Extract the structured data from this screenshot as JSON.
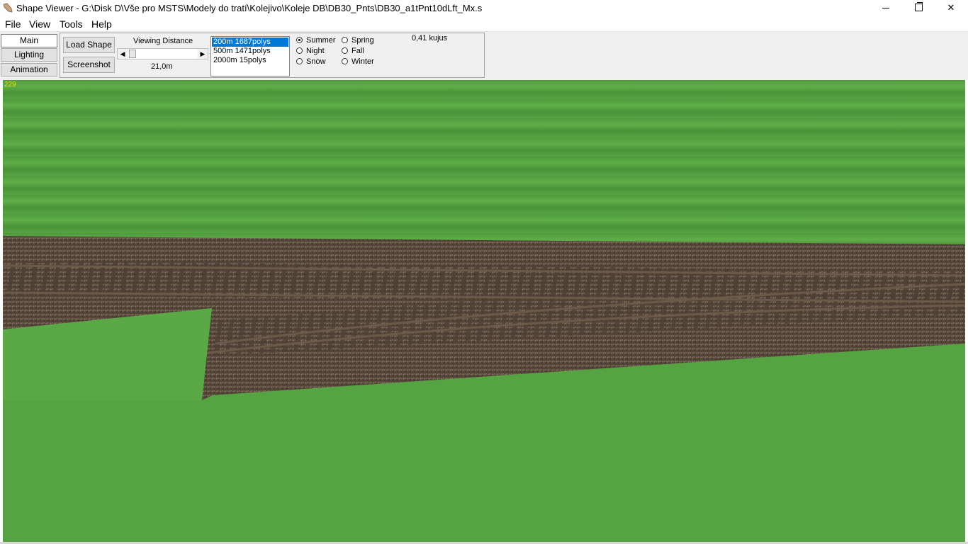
{
  "window": {
    "title": "Shape Viewer - G:\\Disk D\\Vše pro MSTS\\Modely do tratí\\Kolejivo\\Koleje DB\\DB30_Pnts\\DB30_a1tPnt10dLft_Mx.s",
    "minimize_icon": "minimize-icon",
    "restore_icon": "restore-icon",
    "close_label": "✕"
  },
  "menu": {
    "items": [
      "File",
      "View",
      "Tools",
      "Help"
    ]
  },
  "sidebar": {
    "tabs": [
      {
        "label": "Main",
        "active": true
      },
      {
        "label": "Lighting",
        "active": false
      },
      {
        "label": "Animation",
        "active": false
      }
    ]
  },
  "panel": {
    "load_shape_label": "Load Shape",
    "screenshot_label": "Screenshot",
    "viewing_distance_label": "Viewing Distance",
    "viewing_distance_value": "21,0m",
    "lod_options": [
      {
        "label": "200m 1687polys",
        "selected": true
      },
      {
        "label": "500m 1471polys",
        "selected": false
      },
      {
        "label": "2000m 15polys",
        "selected": false
      }
    ],
    "season_options": [
      {
        "label": "Summer",
        "checked": true
      },
      {
        "label": "Night",
        "checked": false
      },
      {
        "label": "Snow",
        "checked": false
      },
      {
        "label": "Spring",
        "checked": false
      },
      {
        "label": "Fall",
        "checked": false
      },
      {
        "label": "Winter",
        "checked": false
      }
    ],
    "objects_count": "0,41 kujus"
  },
  "viewport": {
    "fps": "229",
    "grass_color": "#55a343",
    "ballast_color": "#5a4a3a",
    "rail_color": "#6b5540"
  }
}
